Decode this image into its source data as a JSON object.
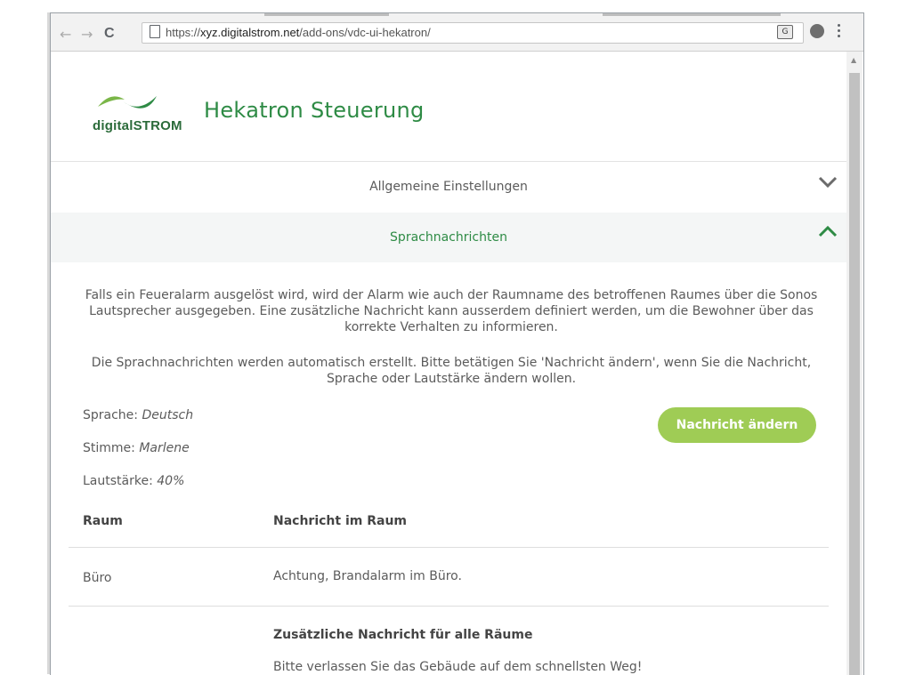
{
  "browser": {
    "url_prefix": "https://",
    "url_host": "xyz.digitalstrom.net",
    "url_path": "/add-ons/vdc-ui-hekatron/",
    "nav_back": "←",
    "nav_forward": "→",
    "nav_reload": "C"
  },
  "header": {
    "logo_text": "digitalSTROM",
    "title": "Hekatron Steuerung"
  },
  "accordion": {
    "general_label": "Allgemeine Einstellungen",
    "voice_label": "Sprachnachrichten"
  },
  "content": {
    "intro": "Falls ein Feueralarm ausgelöst wird, wird der Alarm wie auch der Raumname des betroffenen Raumes über die Sonos Lautsprecher ausgegeben. Eine zusätzliche Nachricht kann ausserdem definiert werden, um die Bewohner über das korrekte Verhalten zu informieren.",
    "info": "Die Sprachnachrichten werden automatisch erstellt. Bitte betätigen Sie 'Nachricht ändern', wenn Sie die Nachricht, Sprache oder Lautstärke ändern wollen.",
    "language_label": "Sprache:",
    "language_value": "Deutsch",
    "voice_label": "Stimme:",
    "voice_value": "Marlene",
    "volume_label": "Lautstärke:",
    "volume_value": "40%",
    "change_button": "Nachricht ändern"
  },
  "table": {
    "col_room": "Raum",
    "col_message": "Nachricht im Raum",
    "rows": [
      {
        "room": "Büro",
        "message": "Achtung, Brandalarm im Büro."
      }
    ],
    "extra_heading": "Zusätzliche Nachricht für alle Räume",
    "extra_message": "Bitte verlassen Sie das Gebäude auf dem schnellsten Weg!"
  },
  "colors": {
    "brand_green": "#2e8b45",
    "button_green": "#9fcc55"
  }
}
